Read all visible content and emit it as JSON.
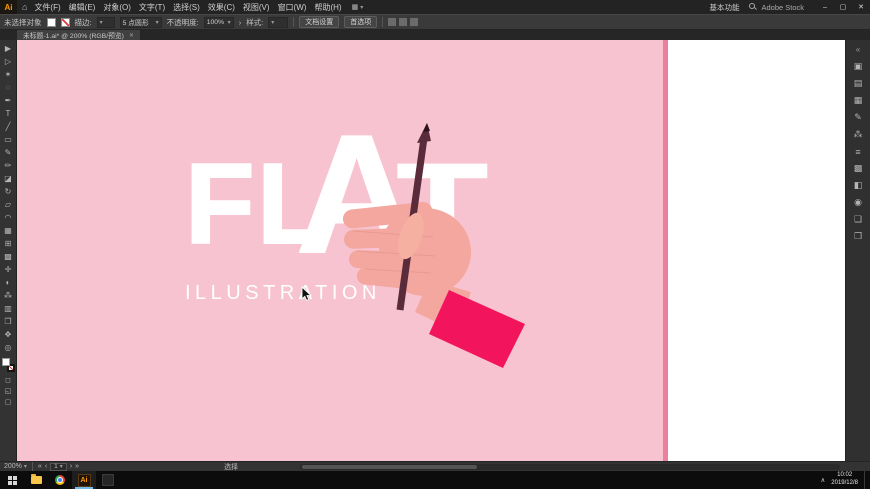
{
  "colors": {
    "pink": "#f8c3d0",
    "pink-stripe": "#ec7f9e",
    "skin": "#f3a79e",
    "skin-light": "#f6b0a2",
    "finger-line": "#e89a92",
    "cuff": "#f2155e",
    "pencil": "#5a2b3a",
    "pencil-dark": "#2b141f",
    "ai-orange": "#ff9a00"
  },
  "icons": {
    "chevron_down": "▾",
    "more": "›",
    "home": "⌂",
    "arrange": "▦",
    "draw_normal": "◻",
    "draw_behind": "◱",
    "screen_mode": "▢"
  },
  "titlebar": {
    "logo": "Ai",
    "menus": [
      {
        "name": "menu-file",
        "label": "文件(F)"
      },
      {
        "name": "menu-edit",
        "label": "编辑(E)"
      },
      {
        "name": "menu-object",
        "label": "对象(O)"
      },
      {
        "name": "menu-type",
        "label": "文字(T)"
      },
      {
        "name": "menu-select",
        "label": "选择(S)"
      },
      {
        "name": "menu-effect",
        "label": "效果(C)"
      },
      {
        "name": "menu-view",
        "label": "视图(V)"
      },
      {
        "name": "menu-window",
        "label": "窗口(W)"
      },
      {
        "name": "menu-help",
        "label": "帮助(H)"
      }
    ],
    "workspace": "基本功能",
    "search_label": "Adobe Stock",
    "window": {
      "minimize": "–",
      "maximize": "▢",
      "close": "✕"
    }
  },
  "controlbar": {
    "no_selection": "未选择对象",
    "stroke_label": "描边:",
    "brush_value": "5 点圆形",
    "opacity_label": "不透明度:",
    "opacity_value": "100%",
    "style_label": "样式:",
    "doc_setup": "文档设置",
    "preferences": "首选项"
  },
  "tabbar": {
    "title": "未标题-1.ai* @ 200% (RGB/预览)",
    "close": "✕"
  },
  "toolbar": {
    "tools": [
      {
        "name": "selection-tool",
        "glyph": "▶"
      },
      {
        "name": "direct-selection-tool",
        "glyph": "▷"
      },
      {
        "name": "magic-wand-tool",
        "glyph": "✶"
      },
      {
        "name": "lasso-tool",
        "glyph": "◌"
      },
      {
        "name": "pen-tool",
        "glyph": "✒"
      },
      {
        "name": "type-tool",
        "glyph": "T"
      },
      {
        "name": "line-segment-tool",
        "glyph": "╱"
      },
      {
        "name": "rectangle-tool",
        "glyph": "▭"
      },
      {
        "name": "paintbrush-tool",
        "glyph": "✎"
      },
      {
        "name": "pencil-tool",
        "glyph": "✏"
      },
      {
        "name": "eraser-tool",
        "glyph": "◪"
      },
      {
        "name": "rotate-tool",
        "glyph": "↻"
      },
      {
        "name": "scale-tool",
        "glyph": "▱"
      },
      {
        "name": "width-tool",
        "glyph": "◠"
      },
      {
        "name": "free-transform-tool",
        "glyph": "▦"
      },
      {
        "name": "mesh-tool",
        "glyph": "⊞"
      },
      {
        "name": "gradient-tool",
        "glyph": "▩"
      },
      {
        "name": "eyedropper-tool",
        "glyph": "✛"
      },
      {
        "name": "blend-tool",
        "glyph": "◐"
      },
      {
        "name": "symbol-sprayer-tool",
        "glyph": "⁂"
      },
      {
        "name": "column-graph-tool",
        "glyph": "▥"
      },
      {
        "name": "artboard-tool",
        "glyph": "❒"
      },
      {
        "name": "hand-tool",
        "glyph": "✥"
      },
      {
        "name": "zoom-tool",
        "glyph": "◎"
      }
    ]
  },
  "panels": {
    "collapse_icon": "«",
    "items": [
      {
        "name": "color-panel-icon",
        "glyph": "▣"
      },
      {
        "name": "color-guide-panel-icon",
        "glyph": "▤"
      },
      {
        "name": "swatches-panel-icon",
        "glyph": "▦"
      },
      {
        "name": "brushes-panel-icon",
        "glyph": "✎"
      },
      {
        "name": "symbols-panel-icon",
        "glyph": "⁂"
      },
      {
        "name": "stroke-panel-icon",
        "glyph": "≡"
      },
      {
        "name": "gradient-panel-icon",
        "glyph": "▩"
      },
      {
        "name": "transparency-panel-icon",
        "glyph": "◧"
      },
      {
        "name": "appearance-panel-icon",
        "glyph": "◉"
      },
      {
        "name": "layers-panel-icon",
        "glyph": "❏"
      },
      {
        "name": "artboards-panel-icon",
        "glyph": "❒"
      }
    ]
  },
  "artwork": {
    "title_letters": [
      "F",
      "L",
      "A",
      "T"
    ],
    "subtitle": "ILLUSTRATION"
  },
  "statusbar": {
    "zoom": "200%",
    "nav_first": "«",
    "nav_prev": "‹",
    "artboard": "1",
    "nav_next": "›",
    "nav_last": "»",
    "status": "选择"
  },
  "taskbar": {
    "ai_label": "Ai",
    "tray_chevron": "∧",
    "time": "10:02",
    "date": "2019/12/8"
  }
}
